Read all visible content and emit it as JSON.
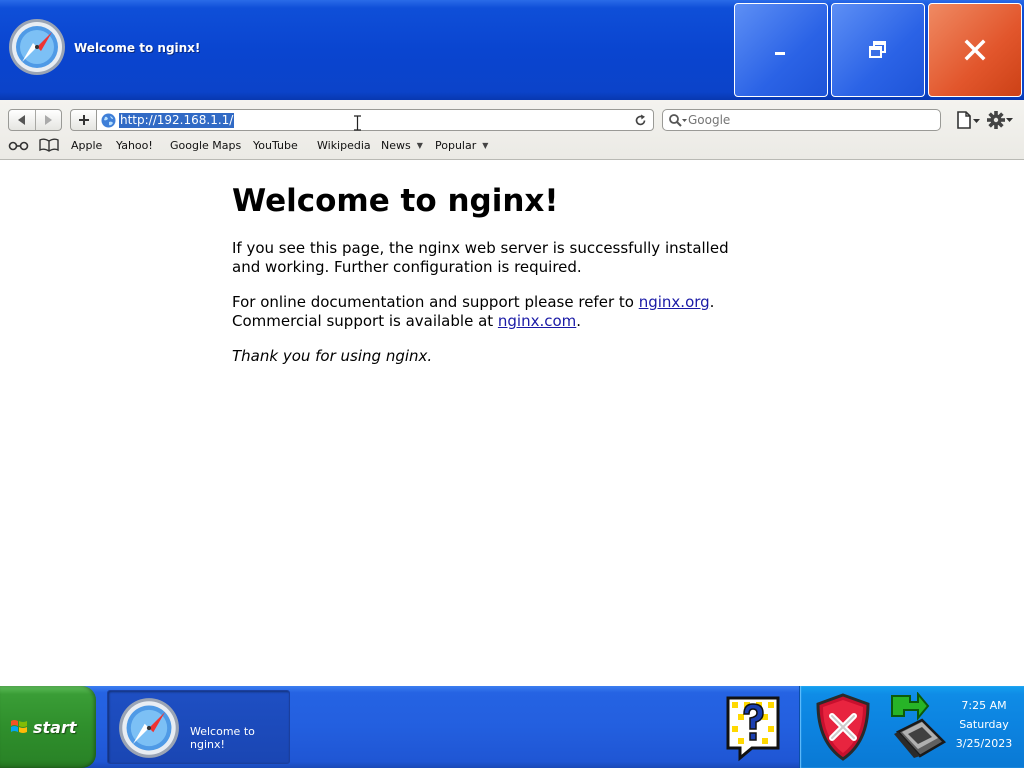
{
  "window": {
    "title": "Welcome to nginx!"
  },
  "toolbar": {
    "url": "http://192.168.1.1/",
    "search_placeholder": "Google"
  },
  "bookmarks": [
    "Apple",
    "Yahoo!",
    "Google Maps",
    "YouTube",
    "Wikipedia",
    "News",
    "Popular"
  ],
  "page": {
    "heading": "Welcome to nginx!",
    "p1": "If you see this page, the nginx web server is successfully installed and working. Further configuration is required.",
    "p2_before": "For online documentation and support please refer to ",
    "p2_link1": "nginx.org",
    "p2_mid": ".",
    "p2_line2": "Commercial support is available at ",
    "p2_link2": "nginx.com",
    "p2_end": ".",
    "p3": "Thank you for using nginx."
  },
  "taskbar": {
    "start_label": "start",
    "task_label": "Welcome to nginx!",
    "clock_time": "7:25 AM",
    "clock_day": "Saturday",
    "clock_date": "3/25/2023"
  },
  "colors": {
    "titlebar_blue": "#0a45d0",
    "close_red": "#e2562c",
    "start_green": "#3a9d36",
    "link": "#1a1aa6",
    "selection": "#316ac5"
  },
  "icons": [
    "safari-compass-icon",
    "minimize-icon",
    "restore-icon",
    "close-icon",
    "back-arrow-icon",
    "forward-arrow-icon",
    "add-icon",
    "globe-icon",
    "reload-icon",
    "search-icon",
    "page-menu-icon",
    "gear-icon",
    "reading-glasses-icon",
    "book-icon",
    "windows-flag-icon",
    "help-icon",
    "security-shield-icon",
    "network-computer-icon"
  ]
}
